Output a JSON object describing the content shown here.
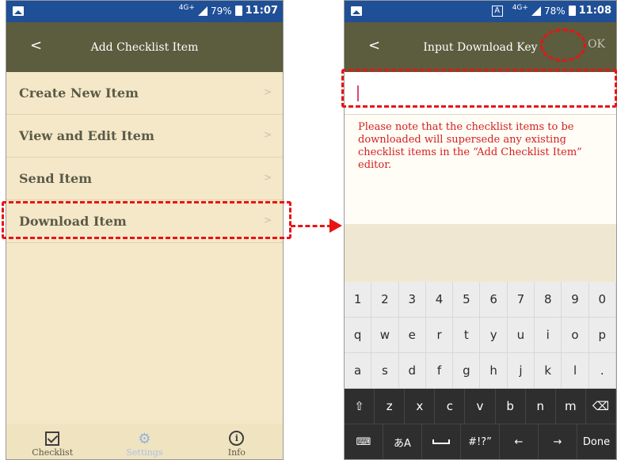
{
  "left_phone": {
    "status": {
      "network": "4G+",
      "battery": "79%",
      "time": "11:07"
    },
    "appbar": {
      "back": "<",
      "title": "Add Checklist Item"
    },
    "menu": [
      {
        "label": "Create New Item",
        "chevron": ">"
      },
      {
        "label": "View and Edit Item",
        "chevron": ">"
      },
      {
        "label": "Send Item",
        "chevron": ">"
      },
      {
        "label": "Download Item",
        "chevron": ">"
      }
    ],
    "tabs": [
      {
        "label": "Checklist",
        "icon": "checkbox-icon"
      },
      {
        "label": "Settings",
        "icon": "gear-icon"
      },
      {
        "label": "Info",
        "icon": "info-icon"
      }
    ]
  },
  "right_phone": {
    "status": {
      "keyboard_indicator": "A",
      "network": "4G+",
      "battery": "78%",
      "time": "11:08"
    },
    "appbar": {
      "back": "<",
      "title": "Input Download Key",
      "ok": "OK"
    },
    "input": {
      "value": "",
      "placeholder": ""
    },
    "notice": "Please note that the checklist items to be downloaded will supersede any existing checklist items in the “Add Checklist Item” editor.",
    "keyboard": {
      "row1": [
        "1",
        "2",
        "3",
        "4",
        "5",
        "6",
        "7",
        "8",
        "9",
        "0"
      ],
      "row2": [
        "q",
        "w",
        "e",
        "r",
        "t",
        "y",
        "u",
        "i",
        "o",
        "p"
      ],
      "row3": [
        "a",
        "s",
        "d",
        "f",
        "g",
        "h",
        "j",
        "k",
        "l",
        "."
      ],
      "row4": [
        "⇧",
        "z",
        "x",
        "c",
        "v",
        "b",
        "n",
        "m",
        "⌫"
      ],
      "row5": [
        "⌨",
        "あA",
        "␣",
        "#!?”",
        "←",
        "→",
        "Done"
      ]
    }
  },
  "annotation_color": "#e81414"
}
